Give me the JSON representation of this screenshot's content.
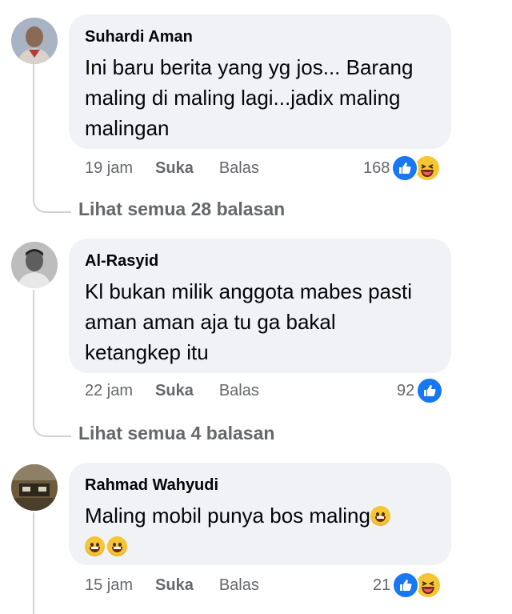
{
  "comments": [
    {
      "author": "Suhardi Aman",
      "lines": [
        "Ini baru berita yang yg jos... Barang",
        "maling di maling lagi...jadix maling",
        "malingan"
      ],
      "time": "19 jam",
      "like_label": "Suka",
      "reply_label": "Balas",
      "reaction_count": "168",
      "reactions": [
        "like-icon",
        "haha-icon"
      ],
      "see_replies": "Lihat semua 28 balasan"
    },
    {
      "author": "Al-Rasyid",
      "lines": [
        "Kl bukan milik anggota mabes pasti",
        "aman aman aja tu ga bakal",
        "ketangkep itu"
      ],
      "time": "22 jam",
      "like_label": "Suka",
      "reply_label": "Balas",
      "reaction_count": "92",
      "reactions": [
        "like-icon"
      ],
      "see_replies": "Lihat semua 4 balasan"
    },
    {
      "author": "Rahmad Wahyudi",
      "lines": [
        "Maling mobil punya bos maling"
      ],
      "emoji": [
        "grinning-face-emoji",
        "grinning-face-emoji",
        "grinning-face-emoji"
      ],
      "time": "15 jam",
      "like_label": "Suka",
      "reply_label": "Balas",
      "reaction_count": "21",
      "reactions": [
        "like-icon",
        "haha-icon"
      ]
    }
  ],
  "colors": {
    "bubble": "#f0f2f5",
    "secondary_text": "#65676b",
    "like_blue": "#1877f2",
    "haha_yellow": "#f7c531"
  }
}
